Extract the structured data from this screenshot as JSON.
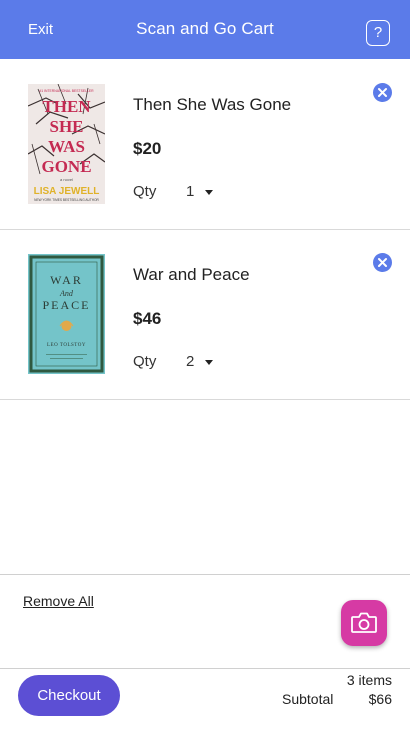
{
  "header": {
    "exit_label": "Exit",
    "title": "Scan and Go Cart",
    "help_label": "?"
  },
  "items": [
    {
      "name": "Then She Was Gone",
      "price": "$20",
      "qty_label": "Qty",
      "qty": "1",
      "cover": {
        "title_words": [
          "THEN",
          "SHE",
          "WAS",
          "GONE"
        ],
        "author": "LISA JEWELL",
        "top_text": "#1 INTERNATIONAL BESTSELLER",
        "bottom_text": "NEW YORK TIMES BESTSELLING AUTHOR",
        "novel_text": "a novel",
        "colors": {
          "background": "#efe8e6",
          "title": "#c42a52",
          "author": "#e0b229"
        }
      }
    },
    {
      "name": "War and Peace",
      "price": "$46",
      "qty_label": "Qty",
      "qty": "2",
      "cover": {
        "title_top": "WAR",
        "title_mid": "And",
        "title_bottom": "PEACE",
        "author": "LEO TOLSTOY",
        "colors": {
          "background": "#74c4c9",
          "border": "#2f5940",
          "ornament": "#e3a94a"
        }
      }
    }
  ],
  "actions": {
    "remove_all_label": "Remove All"
  },
  "footer": {
    "checkout_label": "Checkout",
    "items_count": "3 items",
    "subtotal_label": "Subtotal",
    "subtotal_value": "$66"
  },
  "colors": {
    "header": "#5b7be9",
    "checkout": "#5c4fd4",
    "camera": "#d63aa4",
    "remove_icon": "#5b7be9"
  },
  "icons": {
    "remove": "close-circle-icon",
    "qty_dropdown": "caret-down-icon",
    "camera": "camera-icon",
    "help": "help-icon"
  }
}
